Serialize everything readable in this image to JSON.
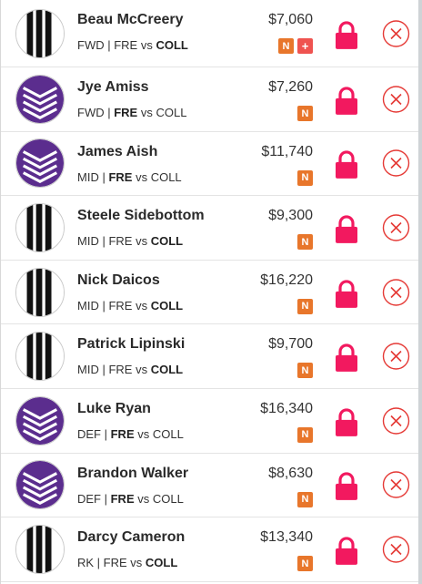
{
  "colors": {
    "accent_pink": "#f2195f",
    "remove_red": "#e53935",
    "badge_orange": "#e8762b",
    "badge_red": "#ef5350",
    "fremantle_purple": "#5b2d8e",
    "collingwood_black": "#111111"
  },
  "players": [
    {
      "name": "Beau McCreery",
      "position": "FWD",
      "team": "COLL",
      "team_label": "FRE",
      "vs": "vs",
      "opp_label": "COLL",
      "bold": "opp",
      "price": "$7,060",
      "badges": [
        {
          "type": "n",
          "label": "N"
        },
        {
          "type": "plus",
          "label": "+"
        }
      ],
      "logo": "collingwood-logo",
      "lock_icon": "lock-icon",
      "remove_icon": "remove-icon"
    },
    {
      "name": "Jye Amiss",
      "position": "FWD",
      "team": "FRE",
      "team_label": "FRE",
      "vs": "vs",
      "opp_label": "COLL",
      "bold": "team",
      "price": "$7,260",
      "badges": [
        {
          "type": "n",
          "label": "N"
        }
      ],
      "logo": "fremantle-logo",
      "lock_icon": "lock-icon",
      "remove_icon": "remove-icon"
    },
    {
      "name": "James Aish",
      "position": "MID",
      "team": "FRE",
      "team_label": "FRE",
      "vs": "vs",
      "opp_label": "COLL",
      "bold": "team",
      "price": "$11,740",
      "badges": [
        {
          "type": "n",
          "label": "N"
        }
      ],
      "logo": "fremantle-logo",
      "lock_icon": "lock-icon",
      "remove_icon": "remove-icon"
    },
    {
      "name": "Steele Sidebottom",
      "position": "MID",
      "team": "COLL",
      "team_label": "FRE",
      "vs": "vs",
      "opp_label": "COLL",
      "bold": "opp",
      "price": "$9,300",
      "badges": [
        {
          "type": "n",
          "label": "N"
        }
      ],
      "logo": "collingwood-logo",
      "lock_icon": "lock-icon",
      "remove_icon": "remove-icon"
    },
    {
      "name": "Nick Daicos",
      "position": "MID",
      "team": "COLL",
      "team_label": "FRE",
      "vs": "vs",
      "opp_label": "COLL",
      "bold": "opp",
      "price": "$16,220",
      "badges": [
        {
          "type": "n",
          "label": "N"
        }
      ],
      "logo": "collingwood-logo",
      "lock_icon": "lock-icon",
      "remove_icon": "remove-icon"
    },
    {
      "name": "Patrick Lipinski",
      "position": "MID",
      "team": "COLL",
      "team_label": "FRE",
      "vs": "vs",
      "opp_label": "COLL",
      "bold": "opp",
      "price": "$9,700",
      "badges": [
        {
          "type": "n",
          "label": "N"
        }
      ],
      "logo": "collingwood-logo",
      "lock_icon": "lock-icon",
      "remove_icon": "remove-icon"
    },
    {
      "name": "Luke Ryan",
      "position": "DEF",
      "team": "FRE",
      "team_label": "FRE",
      "vs": "vs",
      "opp_label": "COLL",
      "bold": "team",
      "price": "$16,340",
      "badges": [
        {
          "type": "n",
          "label": "N"
        }
      ],
      "logo": "fremantle-logo",
      "lock_icon": "lock-icon",
      "remove_icon": "remove-icon"
    },
    {
      "name": "Brandon Walker",
      "position": "DEF",
      "team": "FRE",
      "team_label": "FRE",
      "vs": "vs",
      "opp_label": "COLL",
      "bold": "team",
      "price": "$8,630",
      "badges": [
        {
          "type": "n",
          "label": "N"
        }
      ],
      "logo": "fremantle-logo",
      "lock_icon": "lock-icon",
      "remove_icon": "remove-icon"
    },
    {
      "name": "Darcy Cameron",
      "position": "RK",
      "team": "COLL",
      "team_label": "FRE",
      "vs": "vs",
      "opp_label": "COLL",
      "bold": "opp",
      "price": "$13,340",
      "badges": [
        {
          "type": "n",
          "label": "N"
        }
      ],
      "logo": "collingwood-logo",
      "lock_icon": "lock-icon",
      "remove_icon": "remove-icon"
    }
  ]
}
